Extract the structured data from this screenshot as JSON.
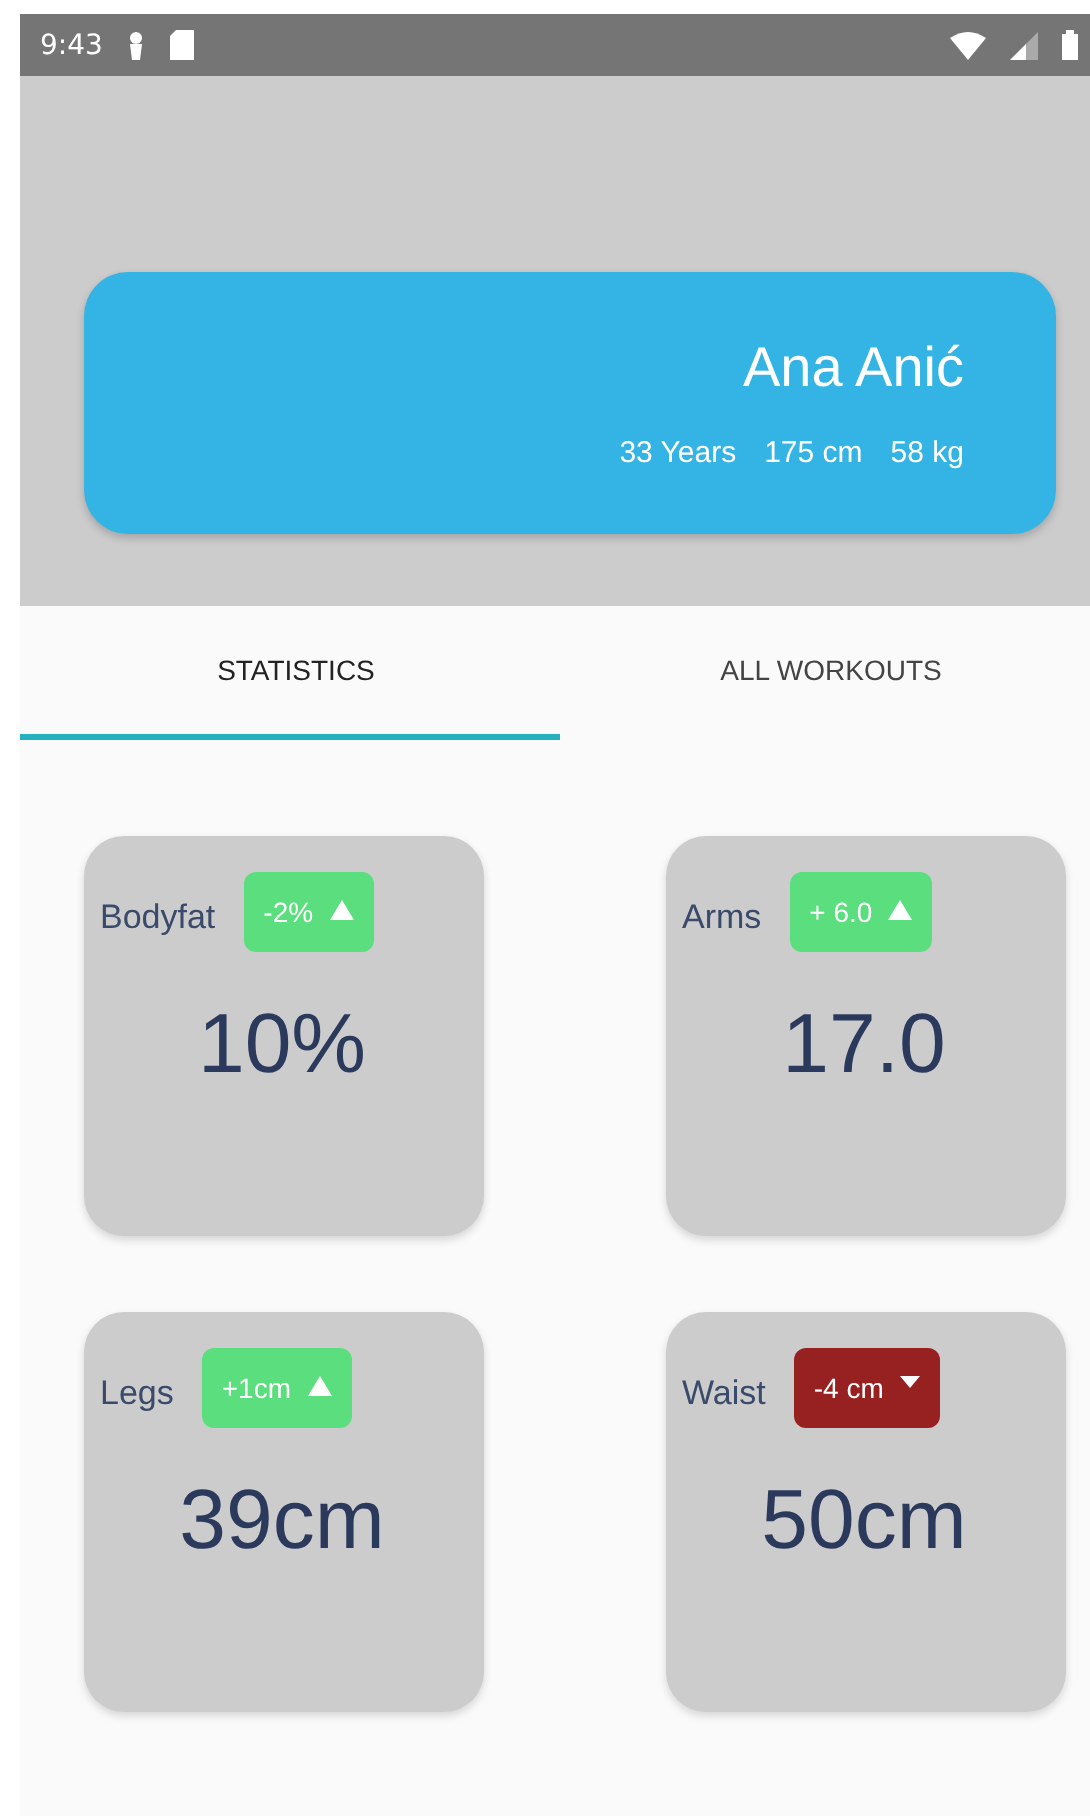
{
  "status_bar": {
    "time": "9:43"
  },
  "profile": {
    "name": "Ana Anić",
    "stats": [
      "33 Years",
      "175 cm",
      "58 kg"
    ]
  },
  "tabs": [
    {
      "label": "STATISTICS",
      "selected": true
    },
    {
      "label": "ALL WORKOUTS",
      "selected": false
    }
  ],
  "cards": [
    {
      "label": "Bodyfat",
      "change": "-2%",
      "kind": "increase",
      "color": "#5ade7e",
      "value": "10%"
    },
    {
      "label": "Arms",
      "change": "+ 6.0",
      "kind": "increase",
      "color": "#5ade7e",
      "value": "17.0"
    },
    {
      "label": "Legs",
      "change": "+1cm",
      "kind": "increase",
      "color": "#5ade7e",
      "value": "39cm"
    },
    {
      "label": "Waist",
      "change": "-4 cm",
      "kind": "decrease",
      "color": "#972121",
      "value": "50cm"
    }
  ]
}
